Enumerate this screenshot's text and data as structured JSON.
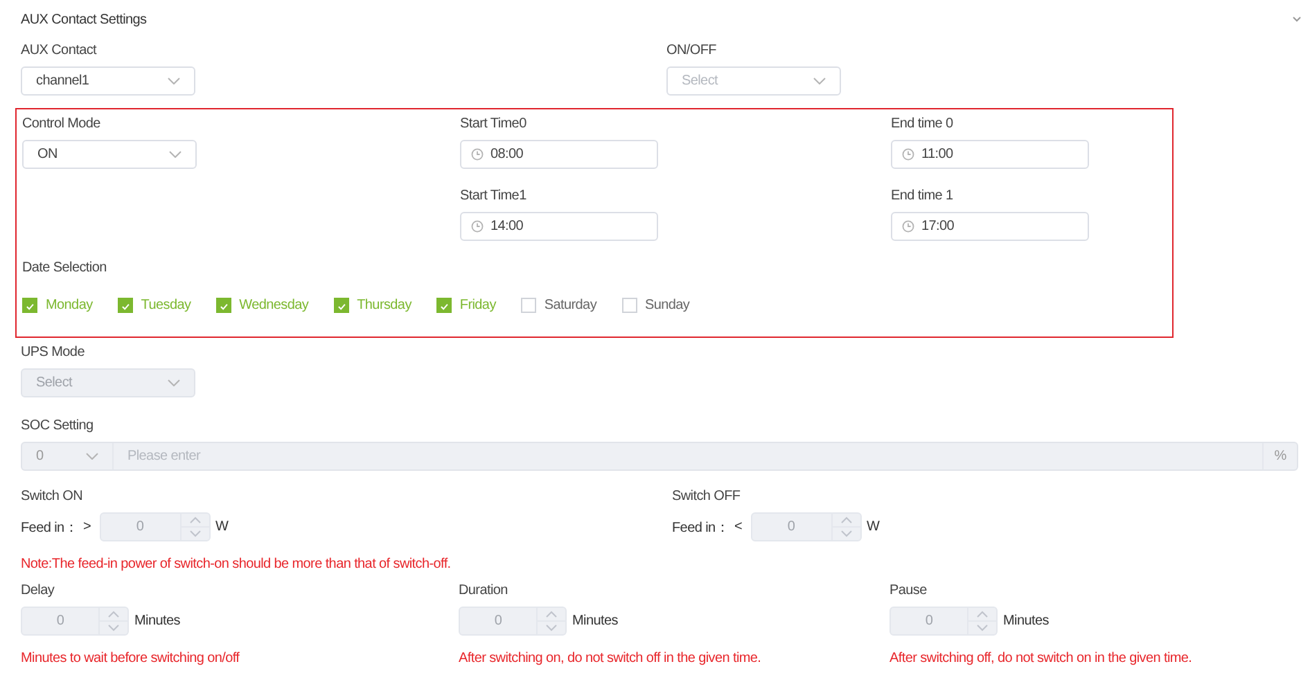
{
  "section_title": "AUX Contact Settings",
  "top_fields": [
    {
      "label": "AUX Contact",
      "value": "channel1"
    },
    {
      "label": "ON/OFF",
      "placeholder": "Select"
    }
  ],
  "schedule": {
    "highlighted": true,
    "control_mode": {
      "label": "Control Mode",
      "value": "ON"
    },
    "times": [
      {
        "label": "Start Time0",
        "value": "08:00"
      },
      {
        "label": "End time 0",
        "value": "11:00"
      },
      {
        "label": "Start Time1",
        "value": "14:00"
      },
      {
        "label": "End time 1",
        "value": "17:00"
      }
    ],
    "date_selection": {
      "label": "Date Selection",
      "days": [
        {
          "label": "Monday",
          "checked": true
        },
        {
          "label": "Tuesday",
          "checked": true
        },
        {
          "label": "Wednesday",
          "checked": true
        },
        {
          "label": "Thursday",
          "checked": true
        },
        {
          "label": "Friday",
          "checked": true
        },
        {
          "label": "Saturday",
          "checked": false
        },
        {
          "label": "Sunday",
          "checked": false
        }
      ]
    }
  },
  "ups_mode": {
    "label": "UPS Mode",
    "placeholder": "Select",
    "disabled": true
  },
  "soc": {
    "label": "SOC Setting",
    "value": "0",
    "placeholder": "Please enter",
    "unit": "%",
    "disabled": true
  },
  "switches": [
    {
      "label": "Switch ON",
      "prefix": "Feed in：",
      "comparator": ">",
      "value": "0",
      "unit": "W",
      "disabled": true
    },
    {
      "label": "Switch OFF",
      "prefix": "Feed in：",
      "comparator": "<",
      "value": "0",
      "unit": "W",
      "disabled": true
    }
  ],
  "note": "Note:The feed-in power of switch-on should be more than that of switch-off.",
  "timers": [
    {
      "label": "Delay",
      "value": "0",
      "unit": "Minutes",
      "hint": "Minutes to wait before switching on/off",
      "disabled": true
    },
    {
      "label": "Duration",
      "value": "0",
      "unit": "Minutes",
      "hint": "After switching on, do not switch off in the given time.",
      "disabled": true
    },
    {
      "label": "Pause",
      "value": "0",
      "unit": "Minutes",
      "hint": "After switching off, do not switch on in the given time.",
      "disabled": true
    }
  ]
}
